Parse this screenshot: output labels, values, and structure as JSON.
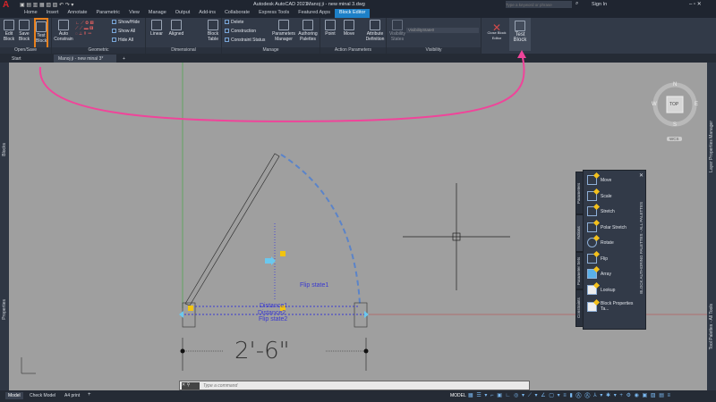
{
  "app": {
    "title": "Autodesk AutoCAD 2021",
    "file": "Manoj ji - new minal 3.dwg",
    "search_placeholder": "Type a keyword or phrase",
    "sign_in": "Sign In"
  },
  "menu_tabs": [
    "Home",
    "Insert",
    "Annotate",
    "Parametric",
    "View",
    "Manage",
    "Output",
    "Add-ins",
    "Collaborate",
    "Express Tools",
    "Featured Apps",
    "Block Editor"
  ],
  "ribbon": {
    "open_save": {
      "title": "Open/Save",
      "edit_block": "Edit Block",
      "save_block": "Save Block",
      "test_block": "Test Block"
    },
    "geometric": {
      "title": "Geometric",
      "auto_constrain": "Auto Constrain",
      "show_hide": "Show/Hide",
      "show_all": "Show All",
      "hide_all": "Hide All"
    },
    "dimensional": {
      "title": "Dimensional",
      "linear": "Linear",
      "aligned": "Aligned",
      "block_table": "Block Table"
    },
    "manage": {
      "title": "Manage",
      "delete": "Delete",
      "construction": "Construction",
      "constraint_status": "Constraint Status",
      "parameters_manager": "Parameters Manager",
      "authoring_palettes": "Authoring Palettes"
    },
    "action_parameters": {
      "title": "Action Parameters",
      "point": "Point",
      "move": "Move",
      "attribute_definition": "Attribute Definition"
    },
    "visibility": {
      "title": "Visibility",
      "visibility_states": "Visibility States",
      "state_value": "VisibilityState0"
    },
    "close": {
      "close_block_editor": "Close Block Editor",
      "test_block": "Test Block"
    }
  },
  "file_tabs": [
    "Start",
    "Manoj ji - new minal 3*"
  ],
  "side_labels": {
    "left_top": "Blocks",
    "left_bottom": "Properties",
    "right_top": "Layer Properties Manager",
    "right_bottom": "Tool Palettes - All Tools"
  },
  "viewcube": {
    "n": "N",
    "s": "S",
    "e": "E",
    "w": "W",
    "top": "TOP",
    "wcs": "WCS"
  },
  "drawing": {
    "flip_state1": "Flip state1",
    "flip_state2": "Flip state2",
    "distance1": "Distance1",
    "distance2": "Distance2",
    "dimension": "2'-6\""
  },
  "palette": {
    "title": "BLOCK AUTHORING PALETTES - ALL PALETTES",
    "tabs": [
      "Parameters",
      "Actions",
      "Parameter Sets",
      "Constraints"
    ],
    "items": [
      "Move",
      "Scale",
      "Stretch",
      "Polar Stretch",
      "Rotate",
      "Flip",
      "Array",
      "Lookup",
      "Block Properties Ta..."
    ]
  },
  "command": {
    "placeholder": "Type a command"
  },
  "layout_tabs": [
    "Model",
    "Check Model",
    "A4 print"
  ],
  "status": {
    "model": "MODEL"
  },
  "colors": {
    "accent": "#1d80c8",
    "highlight": "#e8801c",
    "arrow": "#f0449a"
  }
}
